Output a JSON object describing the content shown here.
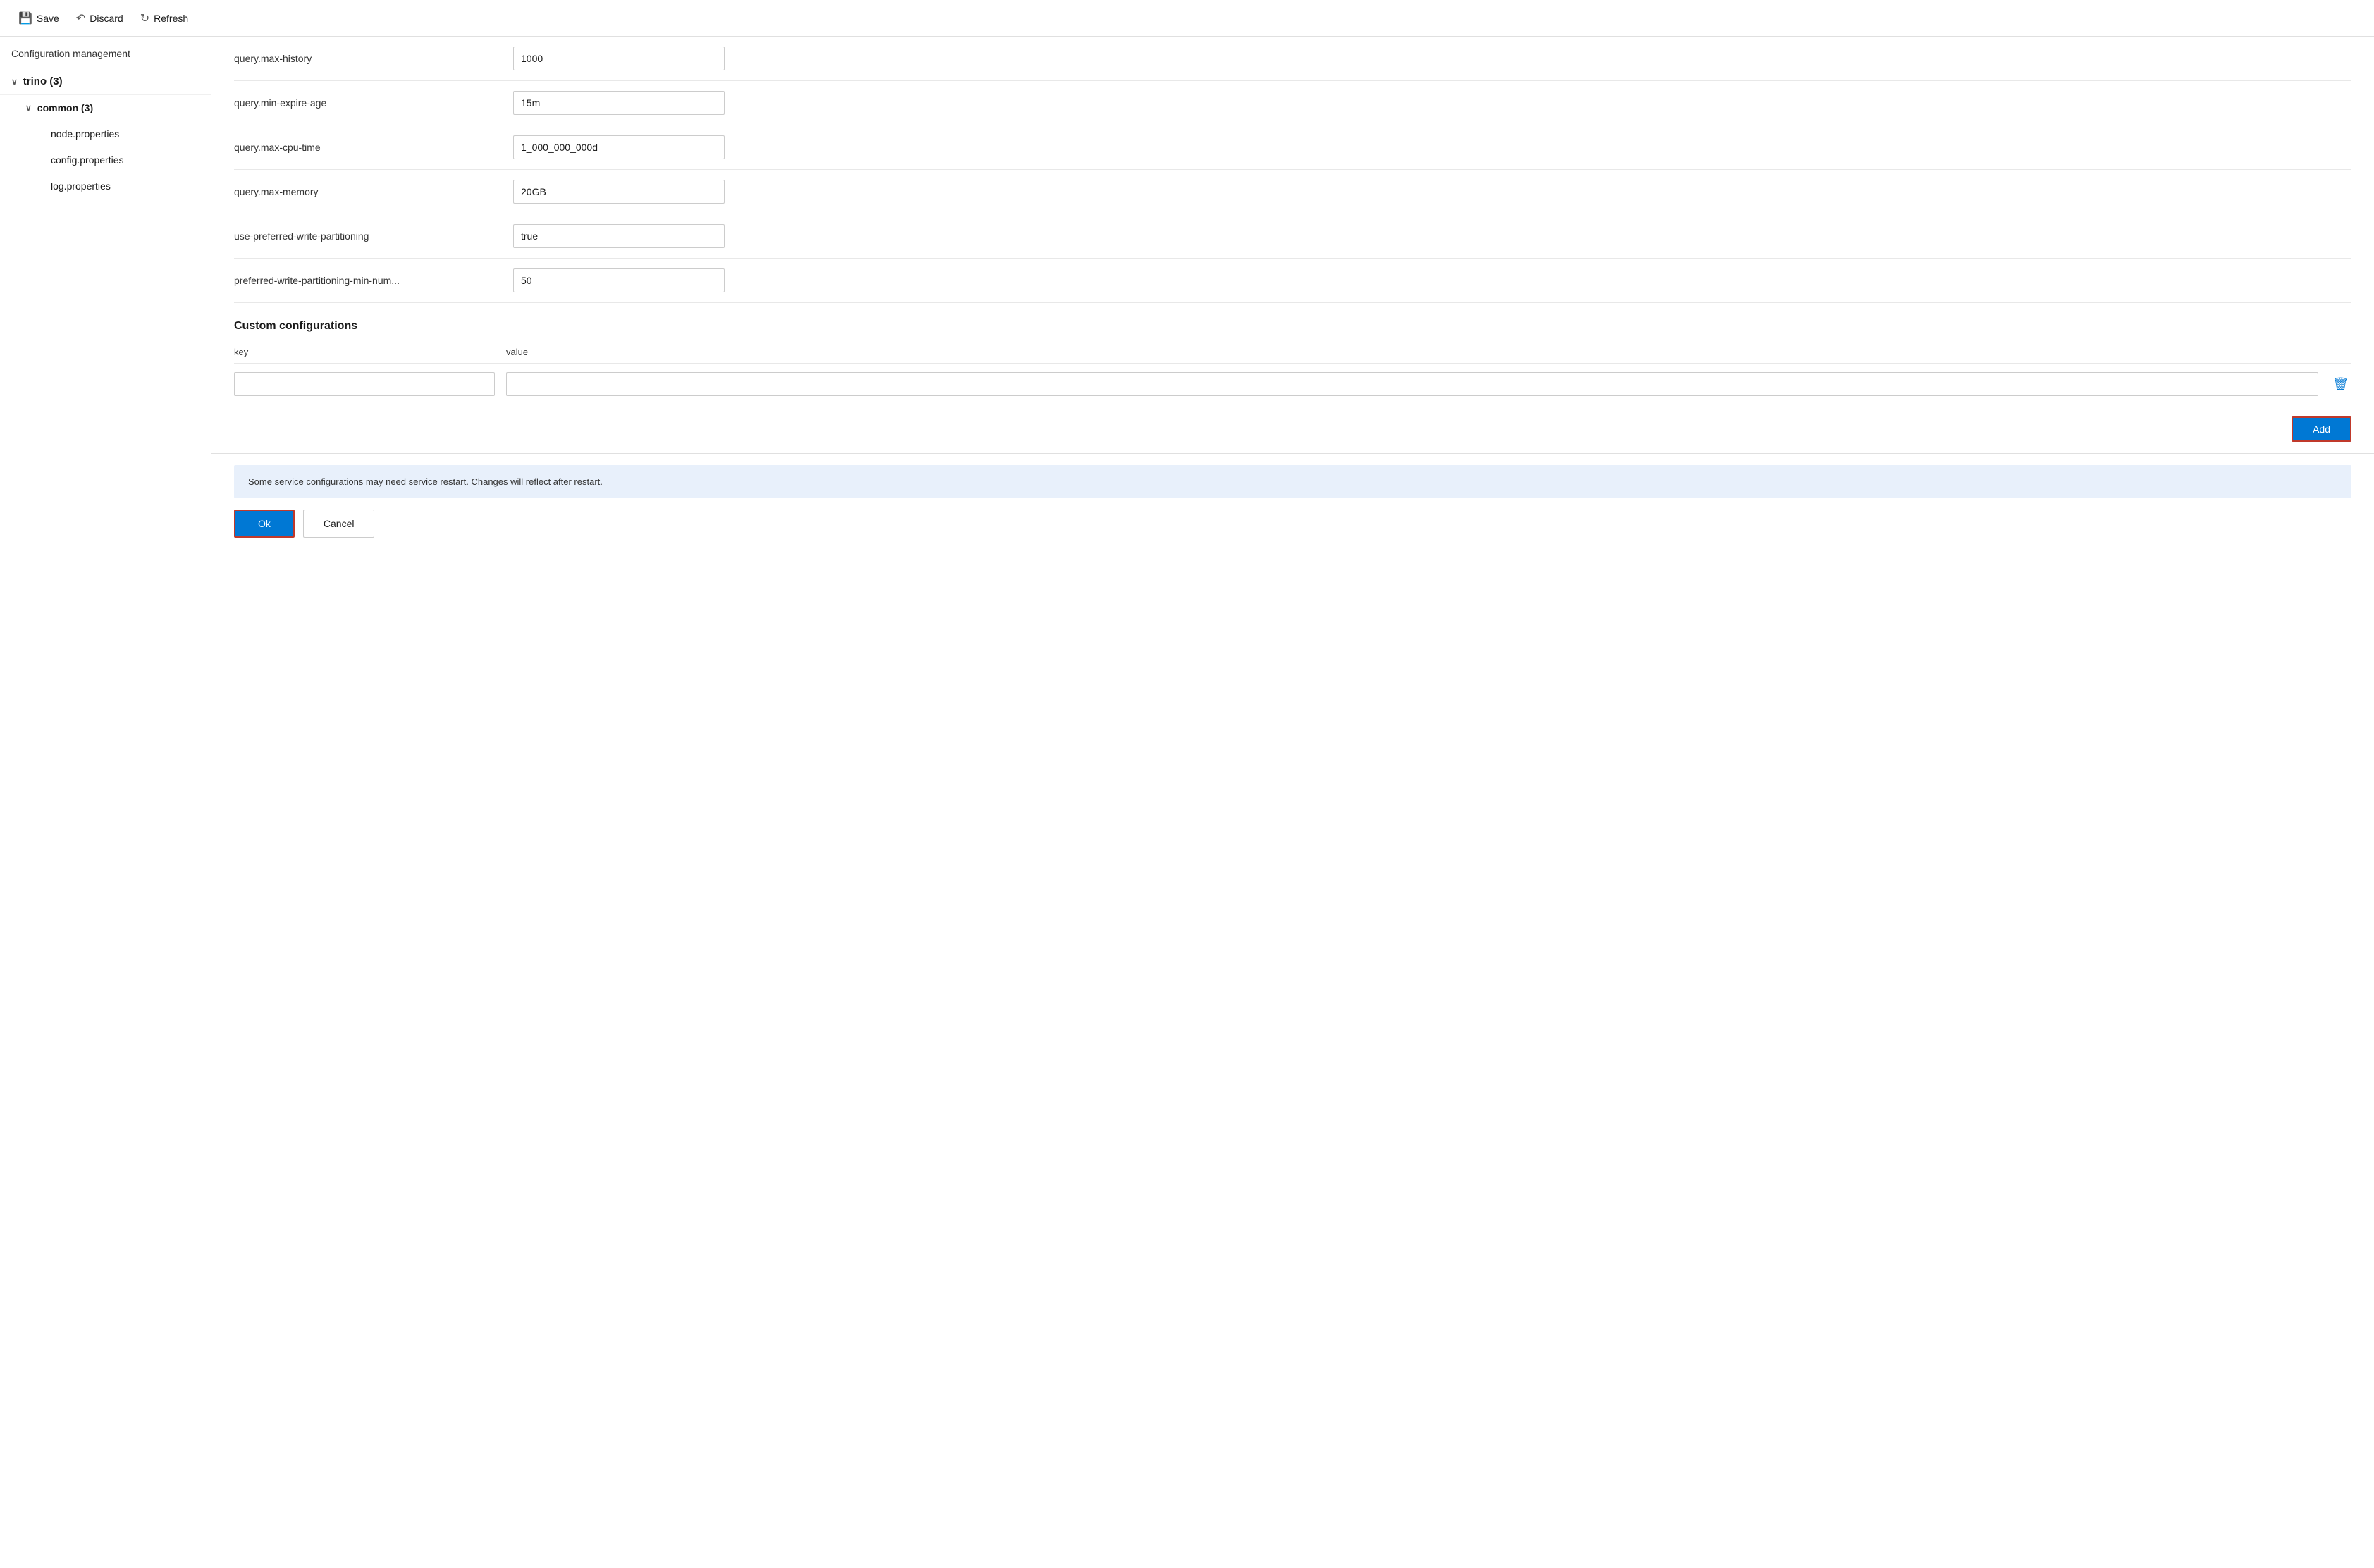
{
  "toolbar": {
    "save_label": "Save",
    "discard_label": "Discard",
    "refresh_label": "Refresh"
  },
  "sidebar": {
    "title": "Configuration management",
    "tree": [
      {
        "label": "trino (3)",
        "level": 0,
        "chevron": "∨",
        "id": "trino"
      },
      {
        "label": "common (3)",
        "level": 1,
        "chevron": "∨",
        "id": "common"
      },
      {
        "label": "node.properties",
        "level": 2,
        "id": "node-props"
      },
      {
        "label": "config.properties",
        "level": 2,
        "id": "config-props"
      },
      {
        "label": "log.properties",
        "level": 2,
        "id": "log-props"
      }
    ]
  },
  "config_rows": [
    {
      "key": "query.max-history",
      "value": "1000"
    },
    {
      "key": "query.min-expire-age",
      "value": "15m"
    },
    {
      "key": "query.max-cpu-time",
      "value": "1_000_000_000d"
    },
    {
      "key": "query.max-memory",
      "value": "20GB"
    },
    {
      "key": "use-preferred-write-partitioning",
      "value": "true"
    },
    {
      "key": "preferred-write-partitioning-min-num...",
      "value": "50"
    }
  ],
  "custom_section": {
    "title": "Custom configurations",
    "key_label": "key",
    "value_label": "value",
    "key_placeholder": "",
    "value_placeholder": "",
    "add_label": "Add"
  },
  "info_banner": {
    "text": "Some service configurations may need service restart. Changes will reflect after restart."
  },
  "footer": {
    "ok_label": "Ok",
    "cancel_label": "Cancel"
  }
}
